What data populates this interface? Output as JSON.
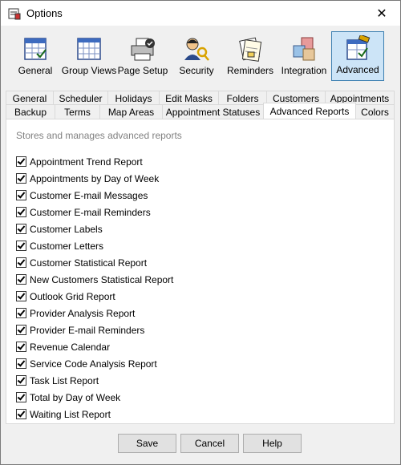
{
  "window": {
    "title": "Options"
  },
  "toolbar": [
    {
      "label": "General",
      "icon": "general-icon"
    },
    {
      "label": "Group Views",
      "icon": "group-views-icon"
    },
    {
      "label": "Page Setup",
      "icon": "printer-icon"
    },
    {
      "label": "Security",
      "icon": "security-key-icon"
    },
    {
      "label": "Reminders",
      "icon": "reminders-icon"
    },
    {
      "label": "Integration",
      "icon": "integration-blocks-icon"
    },
    {
      "label": "Advanced",
      "icon": "advanced-icon",
      "active": true
    }
  ],
  "tabs_row1": [
    "General",
    "Scheduler",
    "Holidays",
    "Edit Masks",
    "Folders",
    "Customers",
    "Appointments"
  ],
  "tabs_row2": [
    "Backup",
    "Terms",
    "Map Areas",
    "Appointment Statuses",
    "Advanced Reports",
    "Colors"
  ],
  "selected_tab": "Advanced Reports",
  "panel": {
    "caption": "Stores and manages advanced reports",
    "items": [
      "Appointment Trend Report",
      "Appointments by Day of Week",
      "Customer E-mail Messages",
      "Customer E-mail Reminders",
      "Customer Labels",
      "Customer Letters",
      "Customer Statistical Report",
      "New Customers Statistical Report",
      "Outlook Grid Report",
      "Provider Analysis Report",
      "Provider E-mail Reminders",
      "Revenue Calendar",
      "Service Code Analysis Report",
      "Task List Report",
      "Total by Day of Week",
      "Waiting List Report"
    ]
  },
  "buttons": {
    "save": "Save",
    "cancel": "Cancel",
    "help": "Help"
  },
  "colors": {
    "active_tool_bg": "#cce4f7",
    "active_tool_border": "#3c7fb1"
  }
}
